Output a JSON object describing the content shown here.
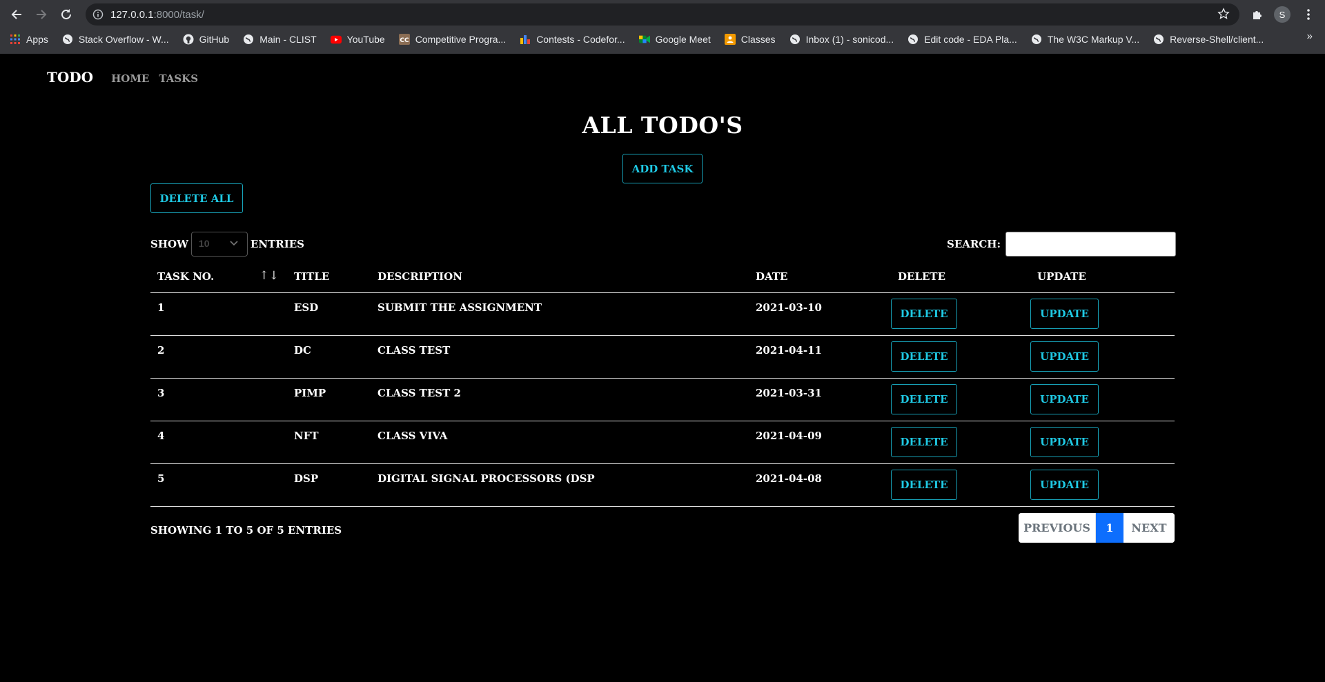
{
  "browser": {
    "url_host": "127.0.0.1",
    "url_path": ":8000/task/",
    "profile_initial": "S",
    "bookmarks": [
      {
        "label": "Apps",
        "icon": "apps-grid-icon"
      },
      {
        "label": "Stack Overflow - W...",
        "icon": "globe-icon"
      },
      {
        "label": "GitHub",
        "icon": "github-icon"
      },
      {
        "label": "Main - CLIST",
        "icon": "globe-icon"
      },
      {
        "label": "YouTube",
        "icon": "youtube-icon"
      },
      {
        "label": "Competitive Progra...",
        "icon": "cc-icon"
      },
      {
        "label": "Contests - Codefor...",
        "icon": "codeforces-icon"
      },
      {
        "label": "Google Meet",
        "icon": "meet-icon"
      },
      {
        "label": "Classes",
        "icon": "classroom-icon"
      },
      {
        "label": "Inbox (1) - sonicod...",
        "icon": "globe-icon"
      },
      {
        "label": "Edit code - EDA Pla...",
        "icon": "globe-icon"
      },
      {
        "label": "The W3C Markup V...",
        "icon": "globe-icon"
      },
      {
        "label": "Reverse-Shell/client...",
        "icon": "globe-icon"
      }
    ],
    "more": "»"
  },
  "nav": {
    "brand": "TODO",
    "links": [
      "HOME",
      "TASKS"
    ]
  },
  "page": {
    "title": "ALL TODO'S",
    "add_task": "ADD TASK",
    "delete_all": "DELETE ALL",
    "show_label": "SHOW",
    "entries_value": "10",
    "entries_label": "ENTRIES",
    "search_label": "SEARCH:",
    "search_value": ""
  },
  "table": {
    "headers": [
      "TASK NO.",
      "TITLE",
      "DESCRIPTION",
      "DATE",
      "DELETE",
      "UPDATE"
    ],
    "rows": [
      {
        "no": "1",
        "title": "ESD",
        "description": "SUBMIT THE ASSIGNMENT",
        "date": "2021-03-10",
        "delete": "DELETE",
        "update": "UPDATE"
      },
      {
        "no": "2",
        "title": "DC",
        "description": "CLASS TEST",
        "date": "2021-04-11",
        "delete": "DELETE",
        "update": "UPDATE"
      },
      {
        "no": "3",
        "title": "PIMP",
        "description": "CLASS TEST 2",
        "date": "2021-03-31",
        "delete": "DELETE",
        "update": "UPDATE"
      },
      {
        "no": "4",
        "title": "NFT",
        "description": "CLASS VIVA",
        "date": "2021-04-09",
        "delete": "DELETE",
        "update": "UPDATE"
      },
      {
        "no": "5",
        "title": "DSP",
        "description": "DIGITAL SIGNAL PROCESSORS (DSP",
        "date": "2021-04-08",
        "delete": "DELETE",
        "update": "UPDATE"
      }
    ]
  },
  "footer": {
    "info": "SHOWING 1 TO 5 OF 5 ENTRIES",
    "previous": "PREVIOUS",
    "current_page": "1",
    "next": "NEXT"
  },
  "colors": {
    "accent": "#17a2b8",
    "accent_text": "#1fc8e3",
    "page_active": "#0d6efd",
    "background": "#000000"
  }
}
